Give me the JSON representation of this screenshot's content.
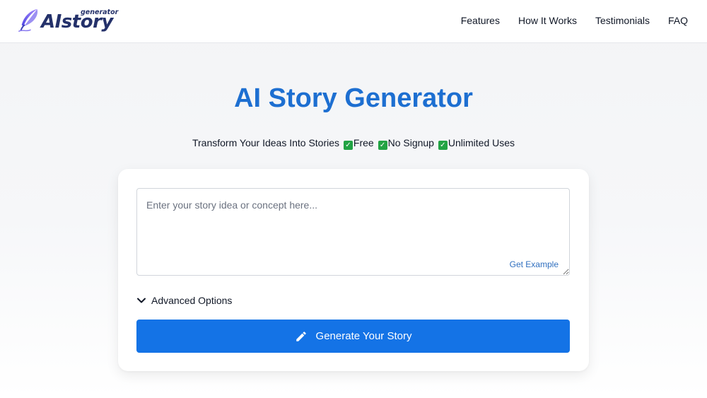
{
  "brand": {
    "name": "AIstory",
    "tagline": "generator",
    "accent_color": "#24316a"
  },
  "nav": {
    "links": [
      "Features",
      "How It Works",
      "Testimonials",
      "FAQ"
    ]
  },
  "hero": {
    "title": "AI Story Generator",
    "title_color": "#1d6fd1",
    "subtitle_lead": "Transform Your Ideas Into Stories",
    "features": [
      "Free",
      "No Signup",
      "Unlimited Uses"
    ],
    "check_icon": "check-mark-icon"
  },
  "form": {
    "story_placeholder": "Enter your story idea or concept here...",
    "story_value": "",
    "get_example_label": "Get Example",
    "advanced_label": "Advanced Options",
    "advanced_icon": "chevron-down-icon",
    "generate_label": "Generate Your Story",
    "generate_icon": "pencil-icon",
    "button_color": "#1473e6"
  }
}
